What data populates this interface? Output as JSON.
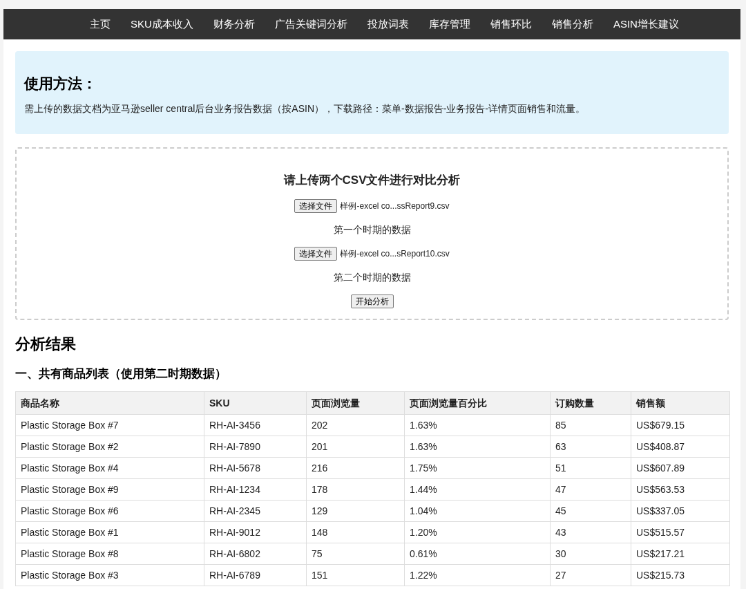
{
  "nav": {
    "items": [
      {
        "label": "主页"
      },
      {
        "label": "SKU成本收入"
      },
      {
        "label": "财务分析"
      },
      {
        "label": "广告关键词分析"
      },
      {
        "label": "投放词表"
      },
      {
        "label": "库存管理"
      },
      {
        "label": "销售环比"
      },
      {
        "label": "销售分析"
      },
      {
        "label": "ASIN增长建议"
      }
    ]
  },
  "usage": {
    "title": "使用方法：",
    "text": "需上传的数据文档为亚马逊seller central后台业务报告数据（按ASIN），下载路径：菜单-数据报告-业务报告-详情页面销售和流量。"
  },
  "upload": {
    "title": "请上传两个CSV文件进行对比分析",
    "files": [
      {
        "button": "选择文件",
        "file_name": "样例-excel co...ssReport9.csv",
        "caption": "第一个时期的数据"
      },
      {
        "button": "选择文件",
        "file_name": "样例-excel co...sReport10.csv",
        "caption": "第二个时期的数据"
      }
    ],
    "submit": "开始分析"
  },
  "results": {
    "title": "分析结果",
    "section_title": "一、共有商品列表（使用第二时期数据）",
    "table": {
      "columns": [
        "商品名称",
        "SKU",
        "页面浏览量",
        "页面浏览量百分比",
        "订购数量",
        "销售额"
      ],
      "rows": [
        [
          "Plastic Storage Box #7",
          "RH-AI-3456",
          "202",
          "1.63%",
          "85",
          "US$679.15"
        ],
        [
          "Plastic Storage Box #2",
          "RH-AI-7890",
          "201",
          "1.63%",
          "63",
          "US$408.87"
        ],
        [
          "Plastic Storage Box #4",
          "RH-AI-5678",
          "216",
          "1.75%",
          "51",
          "US$607.89"
        ],
        [
          "Plastic Storage Box #9",
          "RH-AI-1234",
          "178",
          "1.44%",
          "47",
          "US$563.53"
        ],
        [
          "Plastic Storage Box #6",
          "RH-AI-2345",
          "129",
          "1.04%",
          "45",
          "US$337.05"
        ],
        [
          "Plastic Storage Box #1",
          "RH-AI-9012",
          "148",
          "1.20%",
          "43",
          "US$515.57"
        ],
        [
          "Plastic Storage Box #8",
          "RH-AI-6802",
          "75",
          "0.61%",
          "30",
          "US$217.21"
        ],
        [
          "Plastic Storage Box #3",
          "RH-AI-6789",
          "151",
          "1.22%",
          "27",
          "US$215.73"
        ]
      ]
    }
  }
}
